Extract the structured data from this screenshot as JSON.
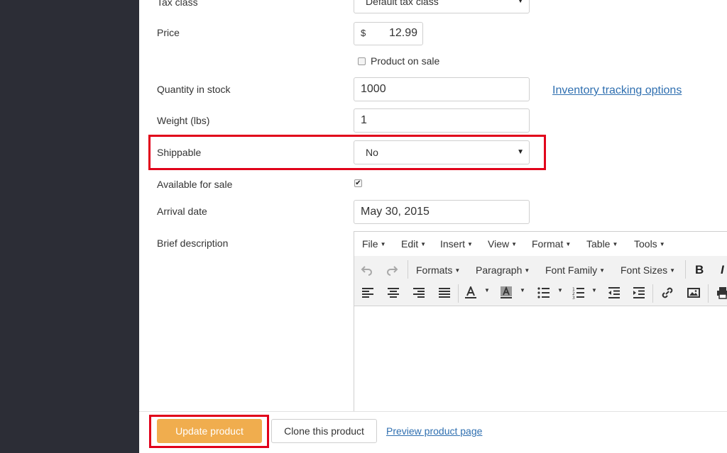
{
  "form": {
    "tax_class": {
      "label": "Tax class",
      "value": "Default tax class"
    },
    "price": {
      "label": "Price",
      "currency": "$",
      "value": "12.99"
    },
    "product_on_sale": {
      "label": "Product on sale",
      "checked": false
    },
    "quantity": {
      "label": "Quantity in stock",
      "value": "1000"
    },
    "inventory_link": "Inventory tracking options",
    "weight": {
      "label": "Weight (lbs)",
      "value": "1"
    },
    "shippable": {
      "label": "Shippable",
      "value": "No"
    },
    "available": {
      "label": "Available for sale",
      "checked": true,
      "check_glyph": "✔"
    },
    "arrival": {
      "label": "Arrival date",
      "value": "May 30, 2015"
    },
    "brief_description": {
      "label": "Brief description"
    }
  },
  "editor": {
    "menu": [
      "File",
      "Edit",
      "Insert",
      "View",
      "Format",
      "Table",
      "Tools"
    ],
    "toolbar": {
      "formats": "Formats",
      "paragraph": "Paragraph",
      "font_family": "Font Family",
      "font_sizes": "Font Sizes",
      "bold": "B",
      "italic": "I"
    },
    "icons": [
      "undo-icon",
      "redo-icon",
      "align-left-icon",
      "align-center-icon",
      "align-right-icon",
      "align-justify-icon",
      "text-color-icon",
      "background-color-icon",
      "bullet-list-icon",
      "numbered-list-icon",
      "outdent-icon",
      "indent-icon",
      "link-icon",
      "image-icon",
      "print-icon"
    ]
  },
  "footer": {
    "update": "Update product",
    "clone": "Clone this product",
    "preview": "Preview product page"
  },
  "colors": {
    "sidebar": "#2c2d36",
    "primary_button": "#f0ad4e",
    "link": "#2f6fb0",
    "highlight": "#e1001a"
  }
}
